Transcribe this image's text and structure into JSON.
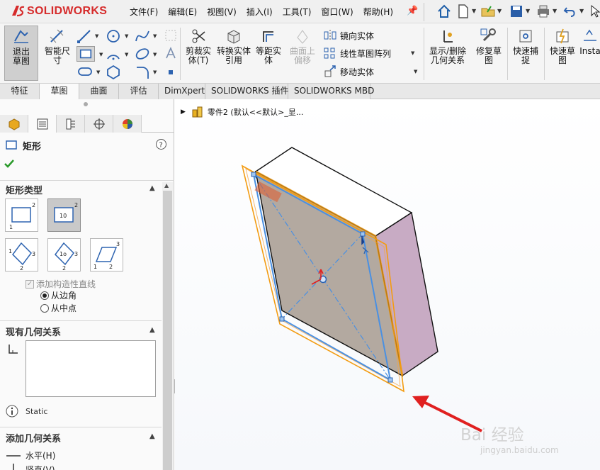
{
  "app": {
    "logo_text": "SOLIDWORKS",
    "logo_mark": "DS"
  },
  "menu": [
    "文件(F)",
    "编辑(E)",
    "视图(V)",
    "插入(I)",
    "工具(T)",
    "窗口(W)",
    "帮助(H)"
  ],
  "ribbon": {
    "exit_sketch": "退出草图",
    "smart_dim": "智能尺寸",
    "trim": "剪裁实体(T)",
    "convert": "转换实体引用",
    "offset": "等距实体",
    "surface_offset": "曲面上偏移",
    "mirror": "镜向实体",
    "linear_pattern": "线性草图阵列",
    "move": "移动实体",
    "show_relations": "显示/删除几何关系",
    "repair": "修复草图",
    "quick_snap": "快速捕捉",
    "rapid_sketch": "快速草图",
    "instant": "Insta"
  },
  "tabs": [
    "特征",
    "草图",
    "曲面",
    "评估",
    "DimXpert",
    "SOLIDWORKS 插件",
    "SOLIDWORKS MBD"
  ],
  "active_tab": "草图",
  "panel": {
    "title": "矩形",
    "rect_type": "矩形类型",
    "add_construction": "添加构造性直线",
    "from_corner": "从边角",
    "from_midpoint": "从中点",
    "existing_relations": "现有几何关系",
    "status": "Static",
    "add_relations": "添加几何关系",
    "horizontal": "水平(H)",
    "vertical": "竖直(V)"
  },
  "tree": {
    "label": "零件2 (默认<<默认>_显..."
  },
  "watermark": {
    "main": "Bai 经验",
    "sub": "jingyan.baidu.com"
  },
  "colors": {
    "accent": "#2e6db8",
    "orange": "#f39c12",
    "face": "#b3a9a0",
    "side": "#c4a9c2",
    "top": "#ffffff",
    "sketch_blue": "#4a90e2",
    "arrow_red": "#e02020"
  }
}
